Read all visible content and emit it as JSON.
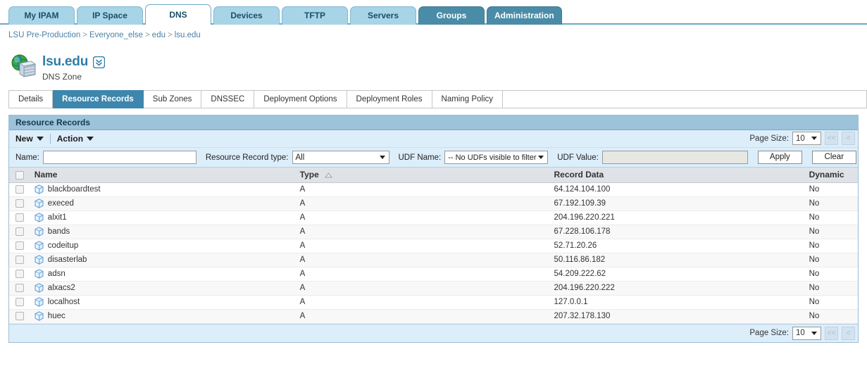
{
  "top_tabs": [
    {
      "label": "My IPAM",
      "state": "normal"
    },
    {
      "label": "IP Space",
      "state": "normal"
    },
    {
      "label": "DNS",
      "state": "active"
    },
    {
      "label": "Devices",
      "state": "normal"
    },
    {
      "label": "TFTP",
      "state": "normal"
    },
    {
      "label": "Servers",
      "state": "normal"
    },
    {
      "label": "Groups",
      "state": "dark"
    },
    {
      "label": "Administration",
      "state": "dark"
    }
  ],
  "breadcrumb": {
    "items": [
      "LSU Pre-Production",
      "Everyone_else",
      "edu",
      "lsu.edu"
    ],
    "separator": ">"
  },
  "page_header": {
    "title": "lsu.edu",
    "subtitle": "DNS Zone",
    "icon": "dns-zone-globe-server-icon",
    "chevron_icon": "double-chevron-down-icon"
  },
  "sub_tabs": [
    {
      "label": "Details",
      "state": "normal"
    },
    {
      "label": "Resource Records",
      "state": "active"
    },
    {
      "label": "Sub Zones",
      "state": "normal"
    },
    {
      "label": "DNSSEC",
      "state": "normal"
    },
    {
      "label": "Deployment Options",
      "state": "normal"
    },
    {
      "label": "Deployment Roles",
      "state": "normal"
    },
    {
      "label": "Naming Policy",
      "state": "normal"
    }
  ],
  "panel": {
    "title": "Resource Records",
    "toolbar": {
      "new_label": "New",
      "action_label": "Action"
    },
    "pagination": {
      "page_size_label": "Page Size:",
      "page_size_value": "10",
      "first_label": "<<",
      "prev_label": "<"
    },
    "filters": {
      "name_label": "Name:",
      "name_value": "",
      "name_placeholder": "",
      "type_label": "Resource Record type:",
      "type_value": "All",
      "udf_name_label": "UDF Name:",
      "udf_name_value": "-- No UDFs visible to filter",
      "udf_value_label": "UDF Value:",
      "udf_value_value": "",
      "apply_label": "Apply",
      "clear_label": "Clear"
    },
    "table": {
      "columns": [
        "Name",
        "Type",
        "Record Data",
        "Dynamic"
      ],
      "sorted_column": "Type",
      "sort_direction": "ascending",
      "rows": [
        {
          "name": "blackboardtest",
          "type": "A",
          "record_data": "64.124.104.100",
          "dynamic": "No"
        },
        {
          "name": "execed",
          "type": "A",
          "record_data": "67.192.109.39",
          "dynamic": "No"
        },
        {
          "name": "alxit1",
          "type": "A",
          "record_data": "204.196.220.221",
          "dynamic": "No"
        },
        {
          "name": "bands",
          "type": "A",
          "record_data": "67.228.106.178",
          "dynamic": "No"
        },
        {
          "name": "codeitup",
          "type": "A",
          "record_data": "52.71.20.26",
          "dynamic": "No"
        },
        {
          "name": "disasterlab",
          "type": "A",
          "record_data": "50.116.86.182",
          "dynamic": "No"
        },
        {
          "name": "adsn",
          "type": "A",
          "record_data": "54.209.222.62",
          "dynamic": "No"
        },
        {
          "name": "alxacs2",
          "type": "A",
          "record_data": "204.196.220.222",
          "dynamic": "No"
        },
        {
          "name": "localhost",
          "type": "A",
          "record_data": "127.0.0.1",
          "dynamic": "No"
        },
        {
          "name": "huec",
          "type": "A",
          "record_data": "207.32.178.130",
          "dynamic": "No"
        }
      ]
    },
    "footer_pagination": {
      "page_size_label": "Page Size:",
      "page_size_value": "10",
      "first_label": "<<",
      "prev_label": "<"
    }
  },
  "colors": {
    "tab_light": "#a8d4e8",
    "tab_dark": "#4a8ca8",
    "accent_blue": "#3d86ad",
    "panel_header": "#9cc3da",
    "toolbar_bg": "#ddeefb",
    "title_blue": "#2d7da6",
    "link_blue": "#4a7fa5"
  }
}
